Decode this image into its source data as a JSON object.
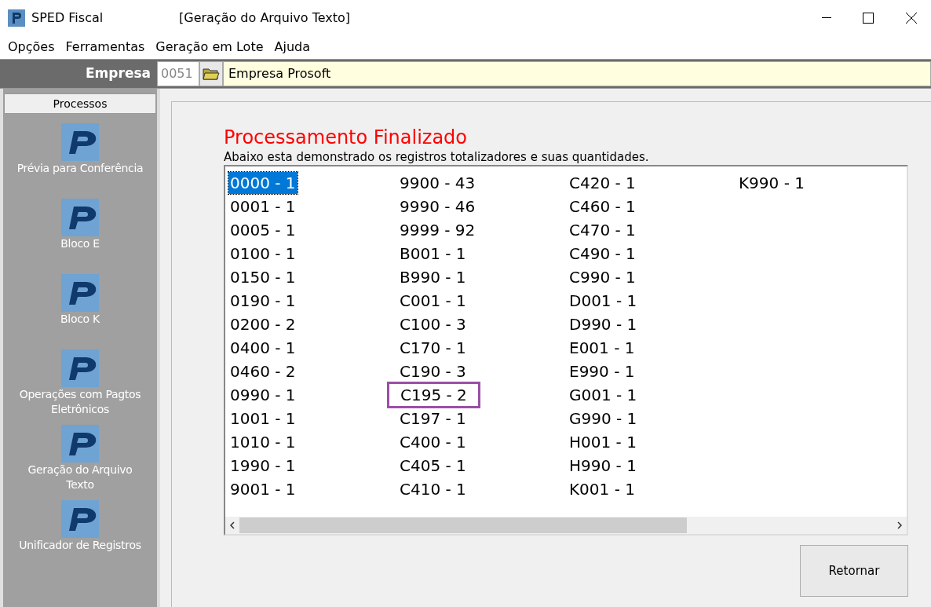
{
  "window": {
    "title": "SPED Fiscal",
    "subtitle": "[Geração do Arquivo Texto]"
  },
  "menu": [
    "Opções",
    "Ferramentas",
    "Geração em Lote",
    "Ajuda"
  ],
  "empresa": {
    "label": "Empresa",
    "code": "0051",
    "name": "Empresa Prosoft"
  },
  "sidebar": {
    "header": "Processos",
    "items": [
      {
        "label": "Prévia para Conferência"
      },
      {
        "label": "Bloco E"
      },
      {
        "label": "Bloco K"
      },
      {
        "label": "Operações com Pagtos Eletrônicos"
      },
      {
        "label": "Geração do Arquivo Texto"
      },
      {
        "label": "Unificador de Registros"
      }
    ]
  },
  "result": {
    "title": "Processamento Finalizado",
    "description": "Abaixo esta demonstrado os registros totalizadores e suas quantidades.",
    "registros": [
      {
        "text": "0000 - 1",
        "selected": true,
        "outlined": false
      },
      {
        "text": "0001 - 1",
        "selected": false,
        "outlined": false
      },
      {
        "text": "0005 - 1",
        "selected": false,
        "outlined": false
      },
      {
        "text": "0100 - 1",
        "selected": false,
        "outlined": false
      },
      {
        "text": "0150 - 1",
        "selected": false,
        "outlined": false
      },
      {
        "text": "0190 - 1",
        "selected": false,
        "outlined": false
      },
      {
        "text": "0200 - 2",
        "selected": false,
        "outlined": false
      },
      {
        "text": "0400 - 1",
        "selected": false,
        "outlined": false
      },
      {
        "text": "0460 - 2",
        "selected": false,
        "outlined": false
      },
      {
        "text": "0990 - 1",
        "selected": false,
        "outlined": false
      },
      {
        "text": "1001 - 1",
        "selected": false,
        "outlined": false
      },
      {
        "text": "1010 - 1",
        "selected": false,
        "outlined": false
      },
      {
        "text": "1990 - 1",
        "selected": false,
        "outlined": false
      },
      {
        "text": "9001 - 1",
        "selected": false,
        "outlined": false
      },
      {
        "text": "9900 - 43",
        "selected": false,
        "outlined": false
      },
      {
        "text": "9990 - 46",
        "selected": false,
        "outlined": false
      },
      {
        "text": "9999 - 92",
        "selected": false,
        "outlined": false
      },
      {
        "text": "B001 - 1",
        "selected": false,
        "outlined": false
      },
      {
        "text": "B990 - 1",
        "selected": false,
        "outlined": false
      },
      {
        "text": "C001 - 1",
        "selected": false,
        "outlined": false
      },
      {
        "text": "C100 - 3",
        "selected": false,
        "outlined": false
      },
      {
        "text": "C170 - 1",
        "selected": false,
        "outlined": false
      },
      {
        "text": "C190 - 3",
        "selected": false,
        "outlined": false
      },
      {
        "text": "C195 - 2",
        "selected": false,
        "outlined": true
      },
      {
        "text": "C197 - 1",
        "selected": false,
        "outlined": false
      },
      {
        "text": "C400 - 1",
        "selected": false,
        "outlined": false
      },
      {
        "text": "C405 - 1",
        "selected": false,
        "outlined": false
      },
      {
        "text": "C410 - 1",
        "selected": false,
        "outlined": false
      },
      {
        "text": "C420 - 1",
        "selected": false,
        "outlined": false
      },
      {
        "text": "C460 - 1",
        "selected": false,
        "outlined": false
      },
      {
        "text": "C470 - 1",
        "selected": false,
        "outlined": false
      },
      {
        "text": "C490 - 1",
        "selected": false,
        "outlined": false
      },
      {
        "text": "C990 - 1",
        "selected": false,
        "outlined": false
      },
      {
        "text": "D001 - 1",
        "selected": false,
        "outlined": false
      },
      {
        "text": "D990 - 1",
        "selected": false,
        "outlined": false
      },
      {
        "text": "E001 - 1",
        "selected": false,
        "outlined": false
      },
      {
        "text": "E990 - 1",
        "selected": false,
        "outlined": false
      },
      {
        "text": "G001 - 1",
        "selected": false,
        "outlined": false
      },
      {
        "text": "G990 - 1",
        "selected": false,
        "outlined": false
      },
      {
        "text": "H001 - 1",
        "selected": false,
        "outlined": false
      },
      {
        "text": "H990 - 1",
        "selected": false,
        "outlined": false
      },
      {
        "text": "K001 - 1",
        "selected": false,
        "outlined": false
      },
      {
        "text": "K990 - 1",
        "selected": false,
        "outlined": false
      }
    ],
    "button": "Retornar"
  }
}
